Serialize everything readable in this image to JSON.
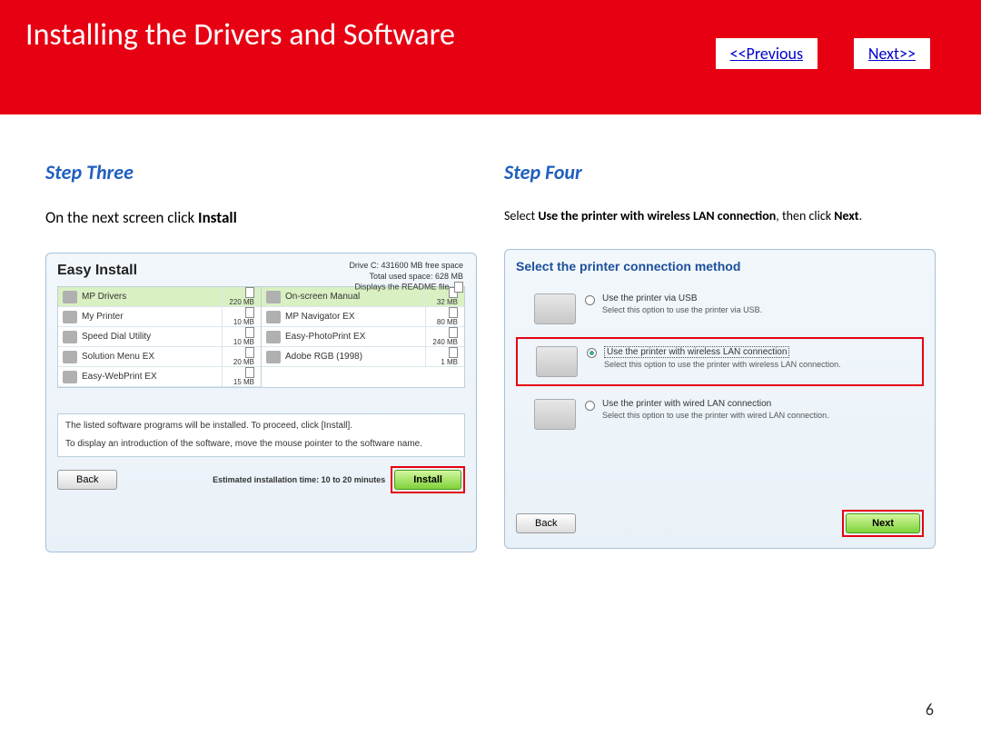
{
  "header": {
    "title": "Installing  the Drivers and Software",
    "prev": "<<Previous",
    "next": "Next>>"
  },
  "left": {
    "heading": "Step Three",
    "instruction_pre": "On the next screen click ",
    "instruction_bold": "Install",
    "dialog": {
      "title": "Easy Install",
      "drive_line1": "Drive C: 431600 MB free space",
      "drive_line2": "Total used space: 628 MB",
      "drive_line3": "Displays the README file",
      "left_items": [
        {
          "name": "MP Drivers",
          "size": "220 MB"
        },
        {
          "name": "My Printer",
          "size": "10 MB"
        },
        {
          "name": "Speed Dial Utility",
          "size": "10 MB"
        },
        {
          "name": "Solution Menu EX",
          "size": "20 MB"
        },
        {
          "name": "Easy-WebPrint EX",
          "size": "15 MB"
        }
      ],
      "right_items": [
        {
          "name": "On-screen Manual",
          "size": "32 MB"
        },
        {
          "name": "MP Navigator EX",
          "size": "80 MB"
        },
        {
          "name": "Easy-PhotoPrint EX",
          "size": "240 MB"
        },
        {
          "name": "Adobe RGB (1998)",
          "size": "1 MB"
        }
      ],
      "note_line1": "The listed software programs will be installed. To proceed, click [Install].",
      "note_line2": "To display an introduction of the software, move the mouse pointer to the software name.",
      "back": "Back",
      "estimate": "Estimated installation time: 10 to 20 minutes",
      "install": "Install"
    }
  },
  "right": {
    "heading": "Step Four",
    "instr_pre": "Select ",
    "instr_bold1": "Use the printer with wireless LAN connection",
    "instr_mid": ", then click ",
    "instr_bold2": "Next",
    "instr_end": ".",
    "dialog": {
      "title": "Select the printer connection method",
      "opt1_label": "Use the printer via USB",
      "opt1_desc": "Select this option to use the printer via USB.",
      "opt2_label": "Use the printer with wireless LAN connection",
      "opt2_desc": "Select this option to use the printer with wireless LAN connection.",
      "opt3_label": "Use the printer with wired LAN connection",
      "opt3_desc": "Select this option to use the printer with wired LAN connection.",
      "back": "Back",
      "next": "Next"
    }
  },
  "page_number": "6"
}
